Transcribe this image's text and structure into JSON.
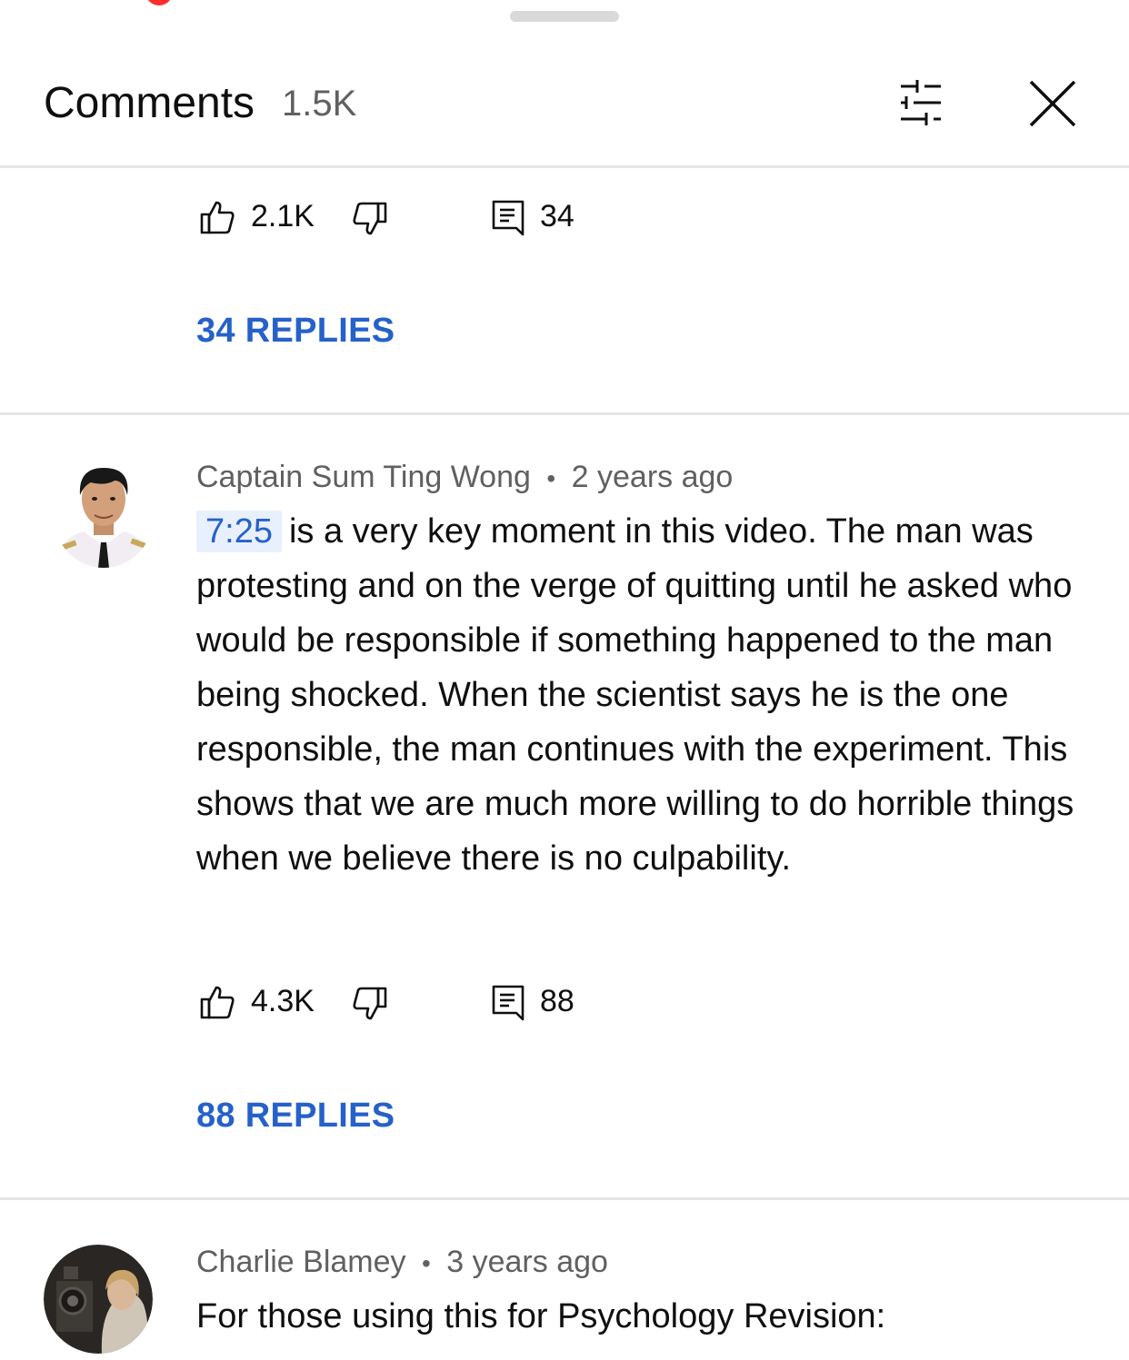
{
  "header": {
    "title": "Comments",
    "count": "1.5K",
    "filter_icon": "sliders-icon",
    "close_icon": "close-icon"
  },
  "thread_top": {
    "likes": "2.1K",
    "reply_count": "34",
    "replies_button": "34 REPLIES"
  },
  "comments": [
    {
      "author": "Captain Sum Ting Wong",
      "separator": "•",
      "time": "2 years ago",
      "timestamp_link": "7:25",
      "text": "is a very key moment in this video. The man was protesting and on the verge of quitting until he asked who would be responsible if something happened to the man being shocked. When the scientist says he is the one responsible, the man continues with the experiment. This shows that we are much more willing to do horrible things when we believe there is no culpability.",
      "likes": "4.3K",
      "reply_count": "88",
      "replies_button": "88 REPLIES"
    },
    {
      "author": "Charlie Blamey",
      "separator": "•",
      "time": "3 years ago",
      "text": "For those using this for Psychology Revision:"
    }
  ],
  "colors": {
    "link_blue": "#2661c9",
    "meta_gray": "#606060",
    "divider": "#e5e5e5",
    "timestamp_bg": "#e8f0fe"
  }
}
